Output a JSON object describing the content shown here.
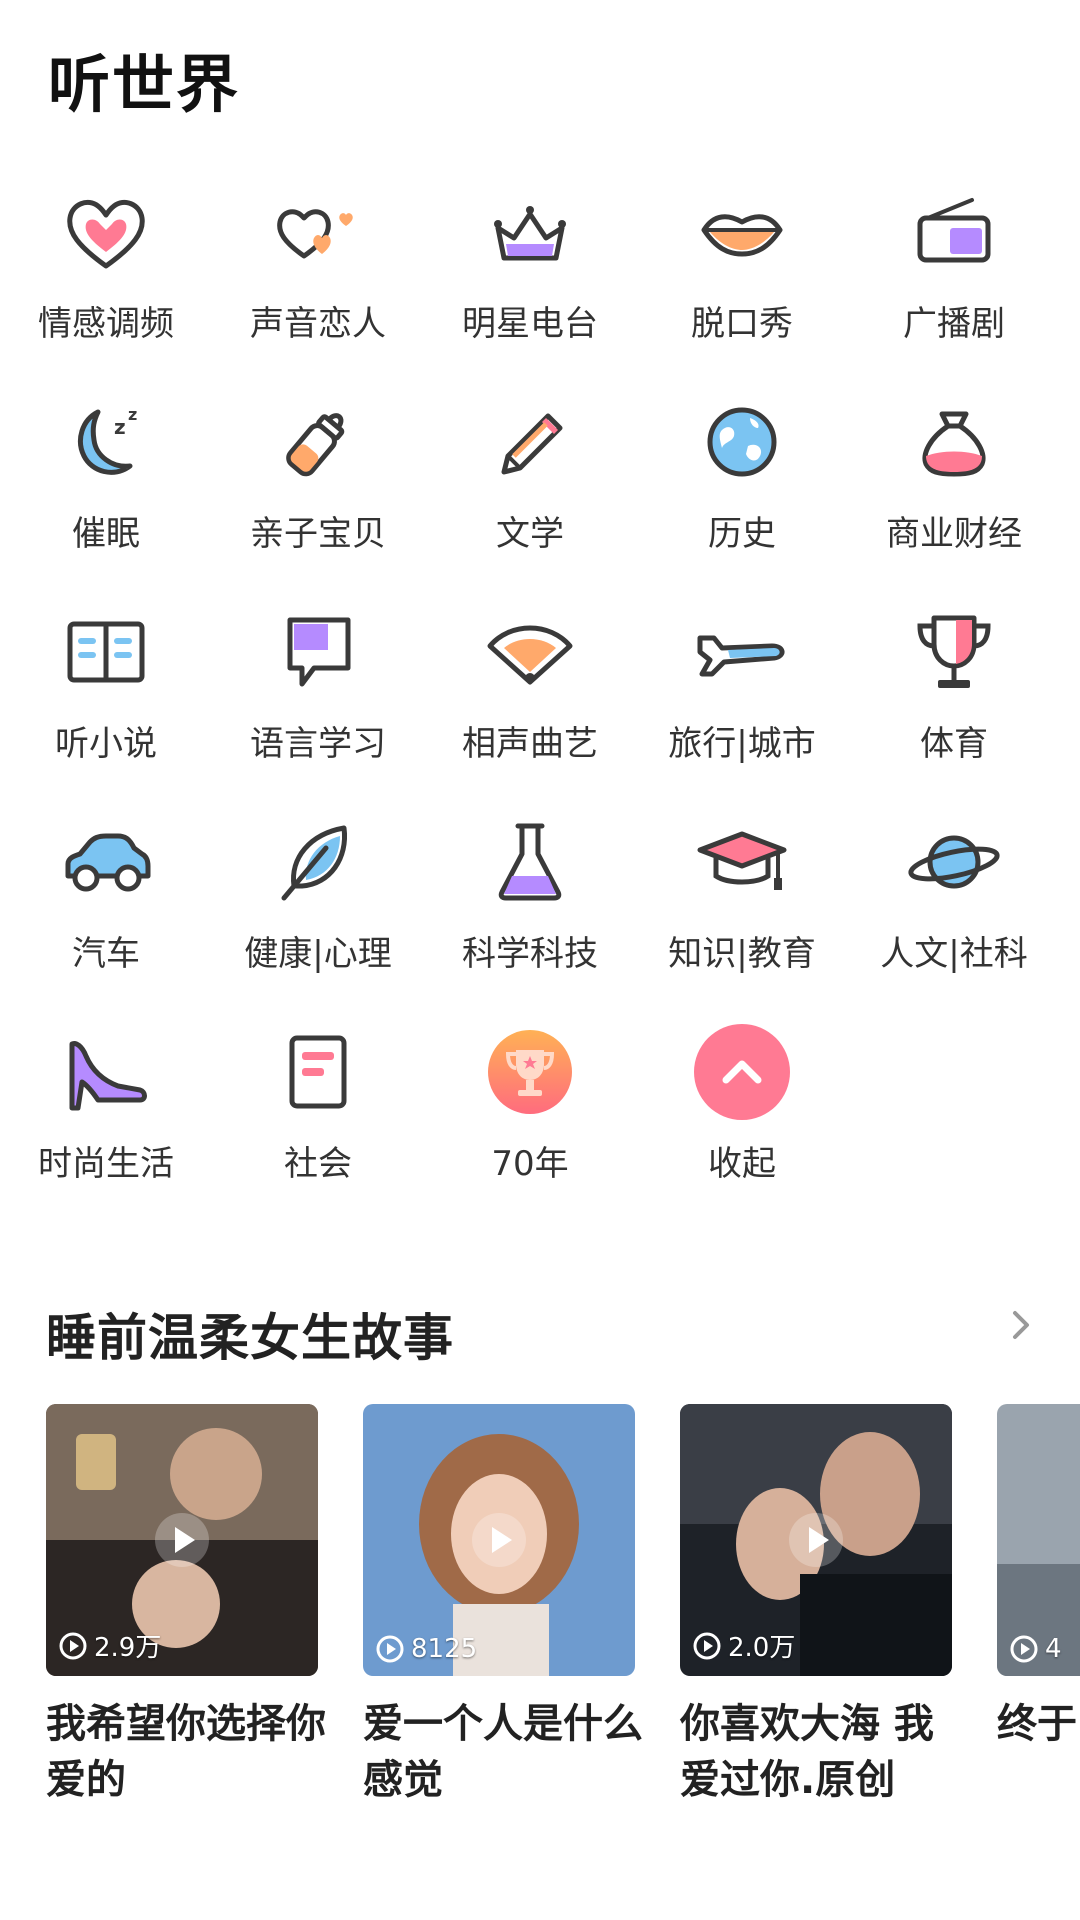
{
  "header": {
    "title": "听世界"
  },
  "categories": [
    {
      "label": "情感调频",
      "icon": "heart-icon"
    },
    {
      "label": "声音恋人",
      "icon": "hearts-icon"
    },
    {
      "label": "明星电台",
      "icon": "crown-icon"
    },
    {
      "label": "脱口秀",
      "icon": "lips-icon"
    },
    {
      "label": "广播剧",
      "icon": "radio-icon"
    },
    {
      "label": "催眠",
      "icon": "moon-icon"
    },
    {
      "label": "亲子宝贝",
      "icon": "baby-bottle-icon"
    },
    {
      "label": "文学",
      "icon": "pencil-icon"
    },
    {
      "label": "历史",
      "icon": "globe-icon"
    },
    {
      "label": "商业财经",
      "icon": "money-bag-icon"
    },
    {
      "label": "听小说",
      "icon": "book-icon"
    },
    {
      "label": "语言学习",
      "icon": "speech-bubble-icon"
    },
    {
      "label": "相声曲艺",
      "icon": "fan-icon"
    },
    {
      "label": "旅行|城市",
      "icon": "airplane-icon"
    },
    {
      "label": "体育",
      "icon": "trophy-icon"
    },
    {
      "label": "汽车",
      "icon": "car-icon"
    },
    {
      "label": "健康|心理",
      "icon": "leaf-icon"
    },
    {
      "label": "科学科技",
      "icon": "flask-icon"
    },
    {
      "label": "知识|教育",
      "icon": "graduation-cap-icon"
    },
    {
      "label": "人文|社科",
      "icon": "planet-icon"
    },
    {
      "label": "时尚生活",
      "icon": "high-heel-icon"
    },
    {
      "label": "社会",
      "icon": "document-icon"
    },
    {
      "label": "70年",
      "icon": "trophy-badge-icon"
    },
    {
      "label": "收起",
      "icon": "chevron-up-icon"
    }
  ],
  "section": {
    "title": "睡前温柔女生故事",
    "more_icon": "chevron-right-icon",
    "cards": [
      {
        "title": "我希望你选择你爱的",
        "play_count": "2.9万"
      },
      {
        "title": "爱一个人是什么感觉",
        "play_count": "8125"
      },
      {
        "title": "你喜欢大海 我爱过你.原创",
        "play_count": "2.0万"
      },
      {
        "title": "终于了 真",
        "play_count": "4"
      }
    ]
  },
  "colors": {
    "accent_pink": "#FF7A93",
    "accent_orange": "#FFA96B",
    "accent_purple": "#B58BFF",
    "accent_blue": "#7BC4F2",
    "outline": "#3A3A3A"
  }
}
